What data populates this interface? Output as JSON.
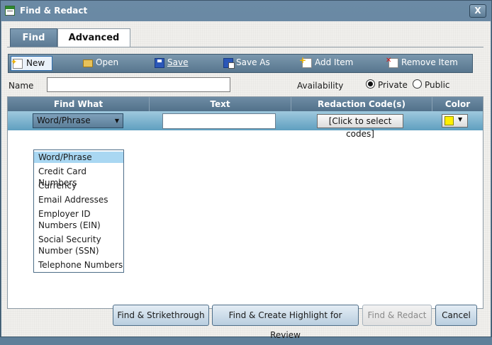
{
  "window": {
    "title": "Find & Redact",
    "close_label": "X"
  },
  "tabs": [
    {
      "label": "Find"
    },
    {
      "label": "Advanced"
    }
  ],
  "toolbar": {
    "new": "New",
    "open": "Open",
    "save": "Save",
    "save_as": "Save As",
    "add_item": "Add Item",
    "remove_item": "Remove Item"
  },
  "form": {
    "name_label": "Name",
    "name_value": "",
    "availability_label": "Availability",
    "private_label": "Private",
    "public_label": "Public",
    "selected_availability": "Private"
  },
  "grid": {
    "headers": [
      "Find What",
      "Text",
      "Redaction Code(s)",
      "Color"
    ],
    "row": {
      "find_what": "Word/Phrase",
      "text": "",
      "codes_button": "[Click to select codes]",
      "color": "#ffef00"
    }
  },
  "dropdown": {
    "items": [
      "Word/Phrase",
      "Credit Card Numbers",
      "Currency",
      "Email Addresses",
      "Employer ID",
      "Numbers (EIN)",
      "Social Security",
      "Number (SSN)",
      "Telephone Numbers"
    ]
  },
  "buttons": {
    "strikethrough": "Find & Strikethrough",
    "highlight": "Find & Create Highlight for Review",
    "redact": "Find & Redact",
    "cancel": "Cancel"
  }
}
